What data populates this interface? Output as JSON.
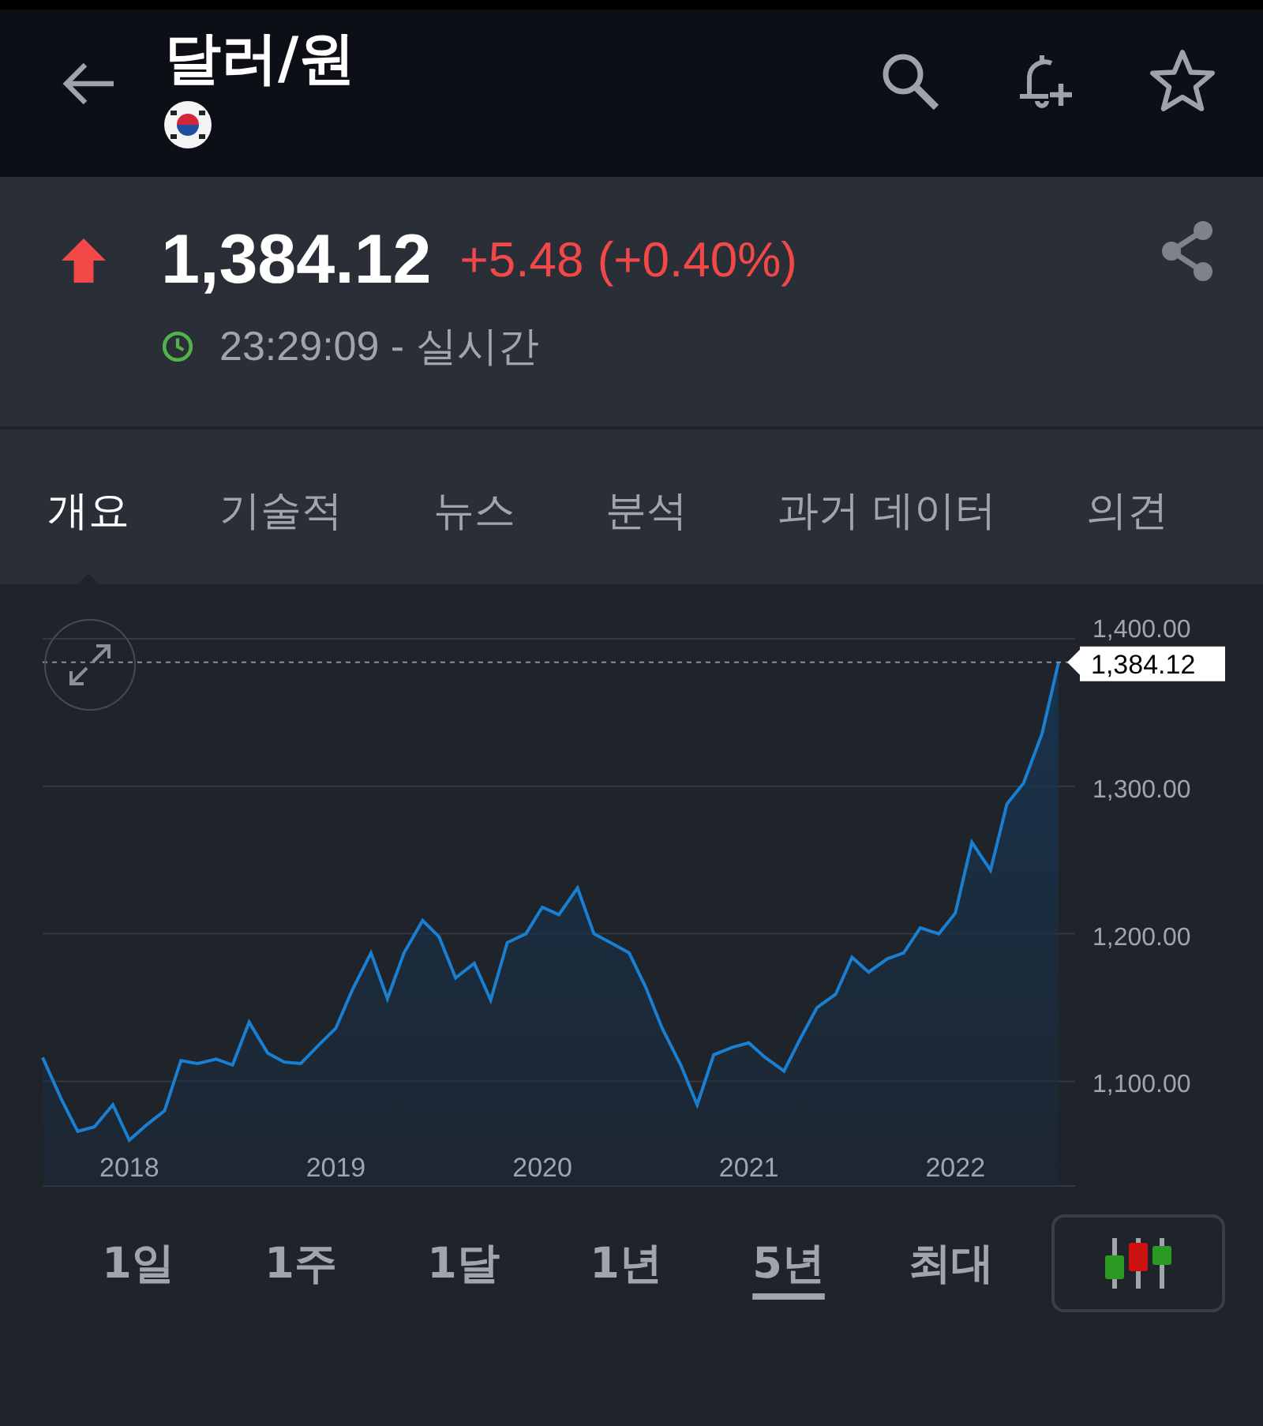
{
  "header": {
    "title": "달러/원"
  },
  "quote": {
    "up": true,
    "price": "1,384.12",
    "change": "+5.48 (+0.40%)",
    "time": "23:29:09 - 실시간"
  },
  "tabs": [
    {
      "label": "개요",
      "selected": true
    },
    {
      "label": "기술적",
      "selected": false
    },
    {
      "label": "뉴스",
      "selected": false
    },
    {
      "label": "분석",
      "selected": false
    },
    {
      "label": "과거 데이터",
      "selected": false
    },
    {
      "label": "의견",
      "selected": false
    }
  ],
  "chart": {
    "chart_data": {
      "type": "area",
      "grid": true,
      "ref_lines": [
        {
          "axis": "y",
          "value": 1384.12,
          "label": "1,384.12"
        }
      ],
      "x": [
        2017.58,
        2017.67,
        2017.75,
        2017.83,
        2017.92,
        2018,
        2018.08,
        2018.17,
        2018.25,
        2018.33,
        2018.42,
        2018.5,
        2018.58,
        2018.67,
        2018.75,
        2018.83,
        2018.92,
        2019,
        2019.08,
        2019.17,
        2019.25,
        2019.33,
        2019.42,
        2019.5,
        2019.58,
        2019.67,
        2019.75,
        2019.83,
        2019.92,
        2020,
        2020.08,
        2020.17,
        2020.25,
        2020.33,
        2020.42,
        2020.5,
        2020.58,
        2020.67,
        2020.75,
        2020.83,
        2020.92,
        2021,
        2021.08,
        2021.17,
        2021.25,
        2021.33,
        2021.42,
        2021.5,
        2021.58,
        2021.67,
        2021.75,
        2021.83,
        2021.92,
        2022,
        2022.08,
        2022.17,
        2022.25,
        2022.33,
        2022.42,
        2022.5
      ],
      "series": [
        {
          "color": "#1a7fd0",
          "values": [
            1116,
            1088,
            1066,
            1069,
            1084,
            1060,
            1070,
            1080,
            1114,
            1112,
            1115,
            1111,
            1140,
            1119,
            1113,
            1112,
            1125,
            1136,
            1162,
            1187,
            1156,
            1187,
            1209,
            1198,
            1170,
            1180,
            1155,
            1194,
            1200,
            1218,
            1213,
            1231,
            1200,
            1194,
            1187,
            1164,
            1136,
            1111,
            1084,
            1118,
            1123,
            1126,
            1116,
            1107,
            1129,
            1150,
            1159,
            1184,
            1174,
            1183,
            1187,
            1204,
            1200,
            1214,
            1262,
            1243,
            1288,
            1302,
            1336,
            1384
          ]
        }
      ],
      "xlim": [
        2017.58,
        2022.58
      ],
      "ylim": [
        1029,
        1400
      ],
      "xticks": [
        2018,
        2019,
        2020,
        2021,
        2022
      ],
      "yticks": [
        {
          "value": 1100,
          "label": "1,100.00"
        },
        {
          "value": 1200,
          "label": "1,200.00"
        },
        {
          "value": 1300,
          "label": "1,300.00"
        },
        {
          "value": 1400,
          "label": "1,400.00"
        }
      ]
    }
  },
  "ranges": [
    {
      "label": "1일",
      "selected": false
    },
    {
      "label": "1주",
      "selected": false
    },
    {
      "label": "1달",
      "selected": false
    },
    {
      "label": "1년",
      "selected": false
    },
    {
      "label": "5년",
      "selected": true
    },
    {
      "label": "최대",
      "selected": false
    }
  ]
}
